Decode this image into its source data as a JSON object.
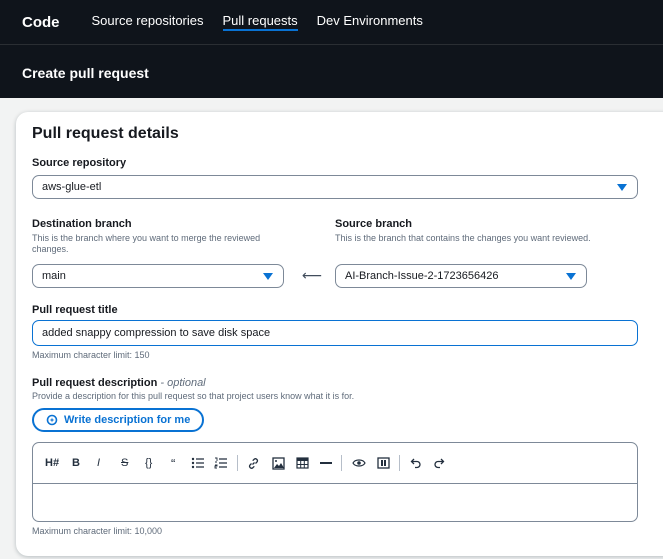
{
  "nav": {
    "brand": "Code",
    "links": [
      "Source repositories",
      "Pull requests",
      "Dev Environments"
    ]
  },
  "header": {
    "title": "Create pull request"
  },
  "form": {
    "title": "Pull request details",
    "source_repository": {
      "label": "Source repository",
      "value": "aws-glue-etl"
    },
    "destination_branch": {
      "label": "Destination branch",
      "description": "This is the branch where you want to merge the reviewed changes.",
      "value": "main"
    },
    "arrow": "⟵",
    "source_branch": {
      "label": "Source branch",
      "description": "This is the branch that contains the changes you want reviewed.",
      "value": "AI-Branch-Issue-2-1723656426"
    },
    "pr_title": {
      "label": "Pull request title",
      "value": "added snappy compression to save disk space",
      "constraint": "Maximum character limit: 150"
    },
    "pr_description": {
      "label": "Pull request description",
      "optional": "- optional",
      "description": "Provide a description for this pull request so that project users know what it is for.",
      "write_button": "Write description for me",
      "constraint": "Maximum character limit: 10,000",
      "toolbar": {
        "heading": "H#",
        "bold": "B",
        "italic": "I",
        "strike": "S",
        "code": "{}",
        "quote": "“"
      }
    }
  },
  "colors": {
    "accent": "#0972d3",
    "nav_bg": "#0f141b"
  }
}
